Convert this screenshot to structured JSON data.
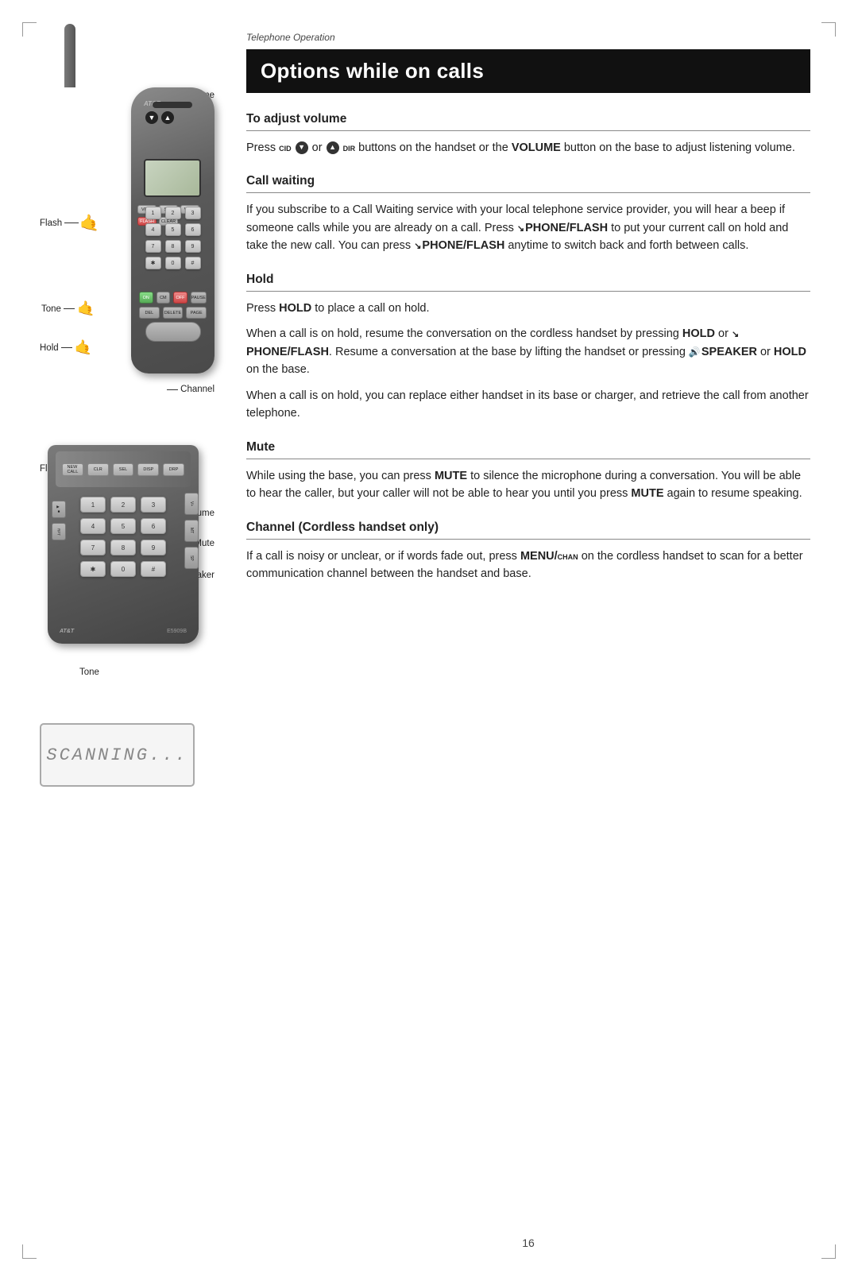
{
  "page": {
    "section_label": "Telephone Operation",
    "title": "Options while on calls",
    "page_number": "16"
  },
  "sections": [
    {
      "id": "adjust-volume",
      "heading": "To adjust volume",
      "body": [
        {
          "type": "paragraph",
          "parts": [
            {
              "text": "Press ",
              "style": "normal"
            },
            {
              "text": "cid",
              "style": "small-bold"
            },
            {
              "text": " or ",
              "style": "normal"
            },
            {
              "text": "dir",
              "style": "small-bold"
            },
            {
              "text": " buttons on the handset or the ",
              "style": "normal"
            },
            {
              "text": "VOLUME",
              "style": "bold"
            },
            {
              "text": " button on the base to adjust listening volume.",
              "style": "normal"
            }
          ]
        }
      ]
    },
    {
      "id": "call-waiting",
      "heading": "Call waiting",
      "body": [
        {
          "type": "paragraph",
          "text": "If you subscribe to a Call Waiting service with your local telephone service provider, you will hear a beep if someone calls while you are already on a call. Press ",
          "suffix_bold": "\\PHONE/FLASH",
          "suffix": " to put your current call on hold and take the new call. You can press ",
          "suffix2_bold": "\\PHONE/FLASH",
          "suffix2": " anytime to switch back and forth between calls."
        }
      ]
    },
    {
      "id": "hold",
      "heading": "Hold",
      "body_lines": [
        "Press HOLD to place a call on hold.",
        "When a call is on hold, resume the conversation on the cordless handset by pressing HOLD or \\PHONE/FLASH. Resume a conversation at the base by lifting the handset or pressing SPEAKER or HOLD on the base.",
        "When a call is on hold, you can replace either handset in its base or charger, and retrieve the call from another telephone."
      ]
    },
    {
      "id": "mute",
      "heading": "Mute",
      "body_text": "While using the base, you can press MUTE to silence the microphone during a conversation. You will be able to hear the caller, but your caller will not be able to hear you until you press MUTE again to resume speaking."
    },
    {
      "id": "channel",
      "heading": "Channel (Cordless handset only)",
      "body_text": "If a call is noisy or unclear, or if words fade out, press MENU/CHAN on the cordless handset to scan for a better communication channel between the handset and base."
    }
  ],
  "left_labels": {
    "flash": "Flash",
    "volume": "Volume",
    "tone": "Tone",
    "hold": "Hold",
    "channel": "Channel",
    "flash2": "Flash",
    "volume2": "Volume",
    "mute": "Mute",
    "speaker": "Speaker",
    "tone2": "Tone",
    "scanning": "SCANNING..."
  }
}
